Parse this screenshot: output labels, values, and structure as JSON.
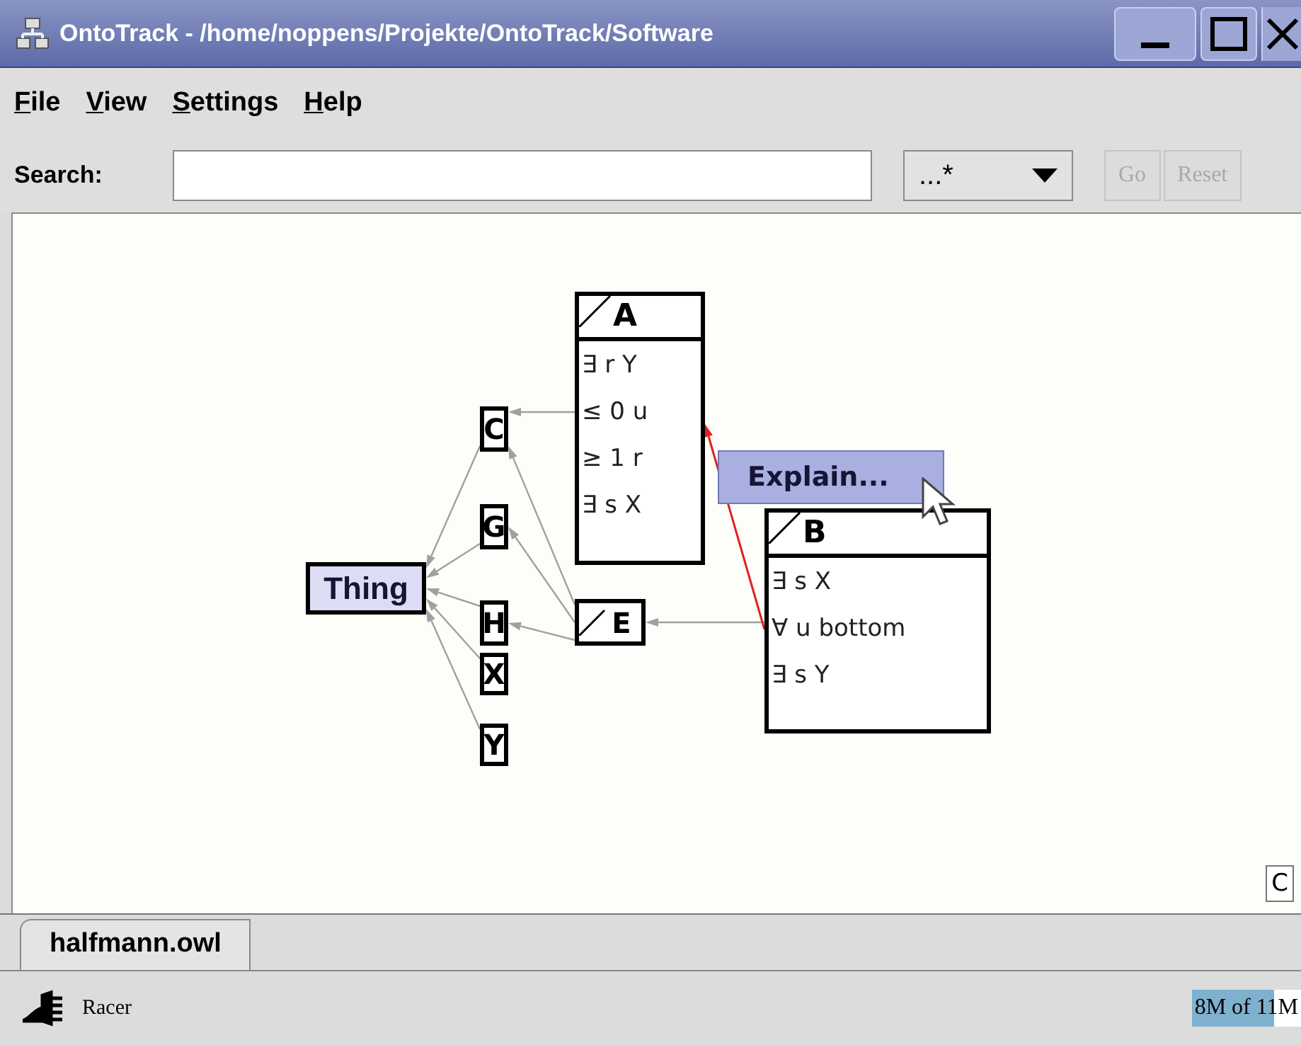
{
  "window": {
    "title": "OntoTrack - /home/noppens/Projekte/OntoTrack/Software"
  },
  "menu": [
    {
      "label": "File"
    },
    {
      "label": "View"
    },
    {
      "label": "Settings"
    },
    {
      "label": "Help"
    }
  ],
  "search": {
    "label": "Search:",
    "mode": "...*",
    "buttons": [
      {
        "label": "Go",
        "disabled": true
      },
      {
        "label": "Reset",
        "disabled": true
      }
    ]
  },
  "diagram": {
    "nodes": [
      {
        "label": "Thing",
        "kind": "root"
      },
      {
        "label": "C",
        "kind": "class"
      },
      {
        "label": "G",
        "kind": "class"
      },
      {
        "label": "H",
        "kind": "class"
      },
      {
        "label": "X",
        "kind": "class"
      },
      {
        "label": "Y",
        "kind": "class"
      },
      {
        "label": "E",
        "kind": "defined"
      },
      {
        "label": "A",
        "kind": "defined",
        "members": [
          "∃ r Y",
          "≤ 0 u",
          "≥ 1 r",
          "∃ s X"
        ]
      },
      {
        "label": "B",
        "kind": "defined",
        "members": [
          "∃ s X",
          "∀ u bottom",
          "∃ s Y"
        ]
      }
    ],
    "context_menu": [
      {
        "label": "Explain...",
        "selected": true
      }
    ],
    "corner_button": "C"
  },
  "tabs": [
    {
      "label": "halfmann.owl",
      "selected": true
    }
  ],
  "status_bar": {
    "reasoner": "Racer",
    "memory": {
      "text": "8M of 11M",
      "level": 0.75
    }
  }
}
